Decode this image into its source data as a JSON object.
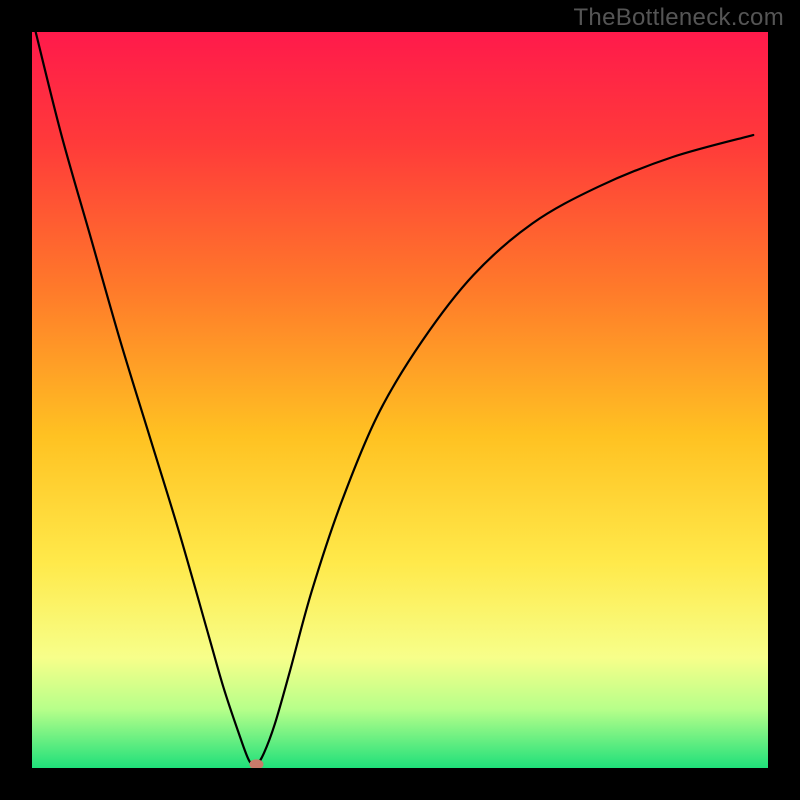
{
  "watermark": "TheBottleneck.com",
  "chart_data": {
    "type": "line",
    "title": "",
    "xlabel": "",
    "ylabel": "",
    "xlim": [
      0,
      100
    ],
    "ylim": [
      0,
      100
    ],
    "grid": false,
    "legend": false,
    "background_gradient": {
      "stops": [
        {
          "pos": 0.0,
          "color": "#ff1a4b"
        },
        {
          "pos": 0.15,
          "color": "#ff3a3a"
        },
        {
          "pos": 0.35,
          "color": "#ff7a2a"
        },
        {
          "pos": 0.55,
          "color": "#ffc222"
        },
        {
          "pos": 0.72,
          "color": "#ffe94a"
        },
        {
          "pos": 0.85,
          "color": "#f7ff8a"
        },
        {
          "pos": 0.92,
          "color": "#b7ff8a"
        },
        {
          "pos": 1.0,
          "color": "#1fe07a"
        }
      ]
    },
    "series": [
      {
        "name": "bottleneck-curve",
        "color": "#000000",
        "x": [
          0.5,
          4,
          8,
          12,
          16,
          20,
          24,
          26,
          28,
          29.5,
          30.5,
          31.5,
          33,
          35,
          38,
          42,
          47,
          53,
          60,
          68,
          77,
          87,
          98
        ],
        "y": [
          100,
          86,
          72,
          58,
          45,
          32,
          18,
          11,
          5,
          1,
          0.5,
          2,
          6,
          13,
          24,
          36,
          48,
          58,
          67,
          74,
          79,
          83,
          86
        ]
      }
    ],
    "marker": {
      "name": "min-point",
      "x": 30.5,
      "y": 0.5,
      "color": "#c97a6a",
      "rx": 7,
      "ry": 5
    }
  }
}
